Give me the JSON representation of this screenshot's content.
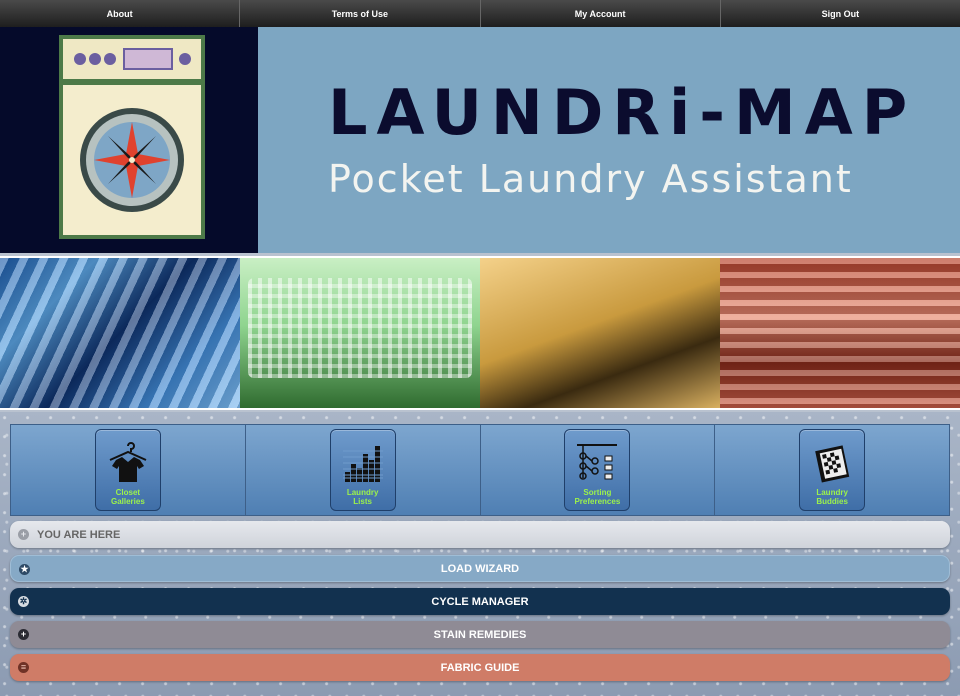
{
  "topnav": {
    "items": [
      {
        "label": "About"
      },
      {
        "label": "Terms of Use"
      },
      {
        "label": "My Account"
      },
      {
        "label": "Sign Out"
      }
    ]
  },
  "header": {
    "title": "LAUNDRi-MAP",
    "subtitle": "Pocket Laundry Assistant",
    "logo_icon": "washing-machine-compass-icon"
  },
  "banner": {
    "panels": [
      "striped-shirts",
      "laundry-baskets",
      "clothesline",
      "folded-towels"
    ]
  },
  "iconbar": {
    "tiles": [
      {
        "label_line1": "Closet",
        "label_line2": "Galleries",
        "icon": "hanger-shirt-icon"
      },
      {
        "label_line1": "Laundry",
        "label_line2": "Lists",
        "icon": "bars-chart-icon"
      },
      {
        "label_line1": "Sorting",
        "label_line2": "Preferences",
        "icon": "sorting-tree-icon"
      },
      {
        "label_line1": "Laundry",
        "label_line2": "Buddies",
        "icon": "book-icon"
      }
    ]
  },
  "accordion": {
    "you_are_here": "YOU ARE HERE",
    "load_wizard": "LOAD WIZARD",
    "cycle_manager": "CYCLE MANAGER",
    "stain_remedies": "STAIN REMEDIES",
    "fabric_guide": "FABRIC GUIDE"
  },
  "colors": {
    "nav_bg": "#2a2a2a",
    "title_bg": "#7da6c2",
    "title_text": "#0b0c2e",
    "tile_label": "#9cf24b",
    "load_wizard": "#86a9c6",
    "cycle_manager": "#12314f",
    "stain_remedies": "#8f8b95",
    "fabric_guide": "#cf7c67"
  }
}
